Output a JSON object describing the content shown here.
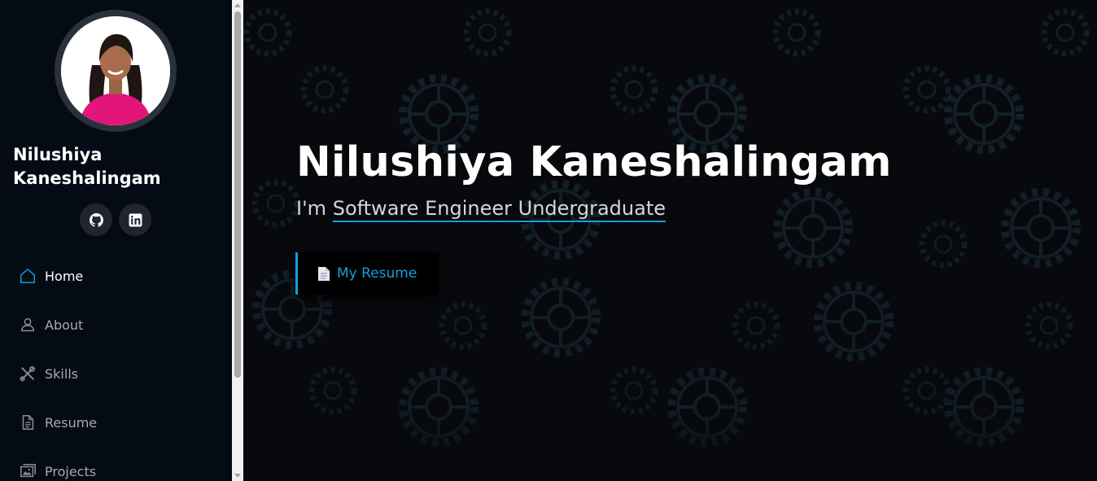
{
  "profile": {
    "name": "Nilushiya Kaneshalingam",
    "social": [
      {
        "icon": "github-icon"
      },
      {
        "icon": "linkedin-icon"
      }
    ]
  },
  "nav": {
    "items": [
      {
        "label": "Home",
        "icon": "home-icon",
        "active": true
      },
      {
        "label": "About",
        "icon": "person-icon",
        "active": false
      },
      {
        "label": "Skills",
        "icon": "tools-icon",
        "active": false
      },
      {
        "label": "Resume",
        "icon": "file-icon",
        "active": false
      },
      {
        "label": "Projects",
        "icon": "images-icon",
        "active": false
      }
    ]
  },
  "hero": {
    "title": "Nilushiya Kaneshalingam",
    "prefix": "I'm",
    "typed": "Software Engineer Undergraduate",
    "resume_button": "My Resume",
    "resume_icon": "document-icon",
    "background": "gears-pattern"
  },
  "colors": {
    "accent": "#149ddd",
    "sidebar_bg": "#040b14",
    "hero_bg": "#07090d"
  }
}
